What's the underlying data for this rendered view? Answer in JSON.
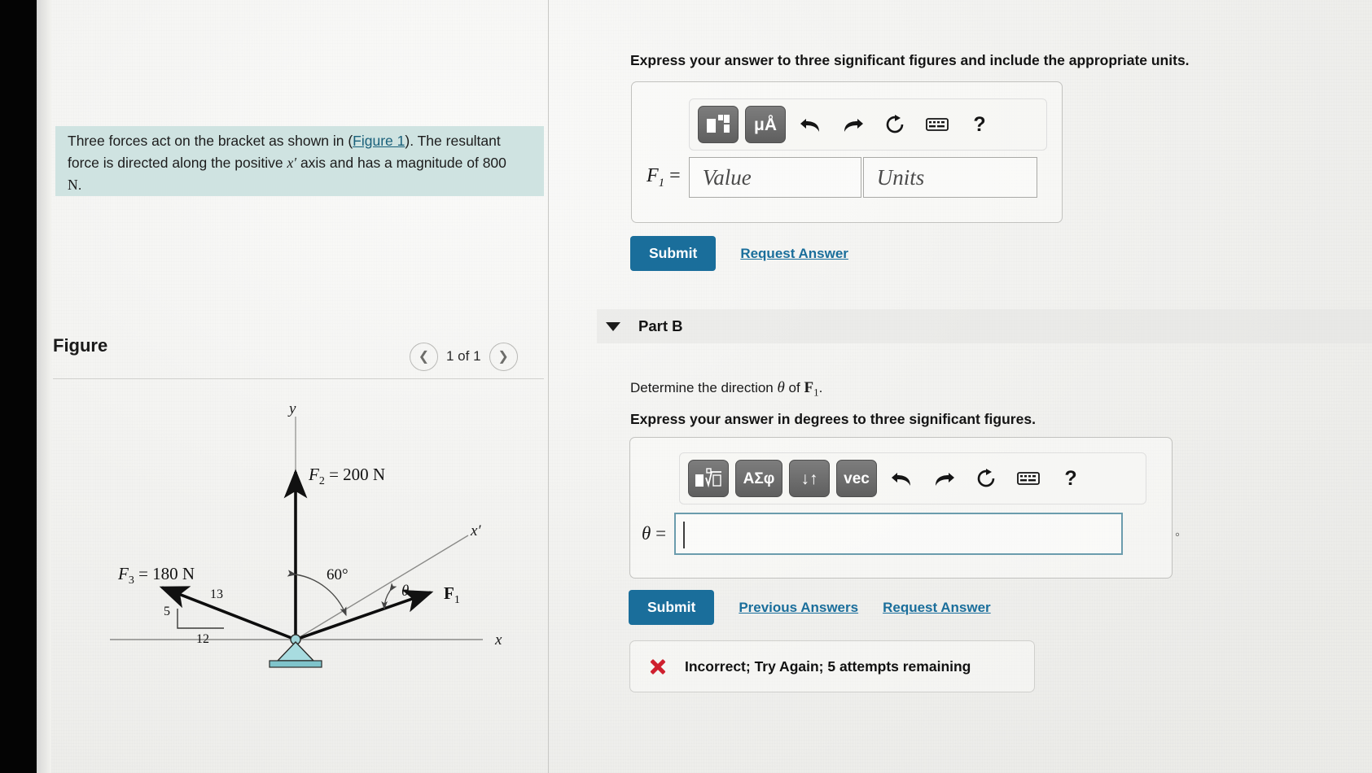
{
  "problem": {
    "text_part1": "Three forces act on the bracket as shown in (",
    "figure_link": "Figure 1",
    "text_part2": "). The resultant force is directed along the positive ",
    "axis_symbol": "x′",
    "text_part3": " axis and has a magnitude of 800 ",
    "unit": "N",
    "text_end": "."
  },
  "figure": {
    "title": "Figure",
    "pager_label": "1 of 1",
    "prev_icon": "chevron-left-icon",
    "next_icon": "chevron-right-icon",
    "labels": {
      "y_axis": "y",
      "x_axis": "x",
      "x_prime_axis": "x′",
      "f2": "F₂ = 200 N",
      "f3": "F₃ = 180 N",
      "f1": "F₁",
      "angle_60": "60°",
      "angle_theta": "θ",
      "slope_hyp": "13",
      "slope_vert": "5",
      "slope_horiz": "12"
    }
  },
  "part_a": {
    "instruction": "Express your answer to three significant figures and include the appropriate units.",
    "variable": "F",
    "variable_sub": "1",
    "equals": "=",
    "value_placeholder": "Value",
    "units_placeholder": "Units",
    "toolbar": {
      "template_key": "template-icon",
      "units_key": "μÅ",
      "undo_icon": "undo-icon",
      "redo_icon": "redo-icon",
      "reset_icon": "reset-icon",
      "keyboard_icon": "keyboard-icon",
      "help_icon": "?"
    },
    "submit_label": "Submit",
    "request_answer_label": "Request Answer"
  },
  "part_b": {
    "header_label": "Part B",
    "collapse_icon": "chevron-down-icon",
    "prompt_pre": "Determine the direction ",
    "prompt_theta": "θ",
    "prompt_mid": " of ",
    "prompt_force": "F",
    "prompt_force_sub": "1",
    "prompt_end": ".",
    "instruction": "Express your answer in degrees to three significant figures.",
    "variable": "θ",
    "equals": "=",
    "answer_value": "",
    "degree_symbol": "°",
    "toolbar": {
      "radical_key": "radical-template-icon",
      "greek_key": "ΑΣφ",
      "updown_key": "↓↑",
      "vec_key": "vec",
      "undo_icon": "undo-icon",
      "redo_icon": "redo-icon",
      "reset_icon": "reset-icon",
      "keyboard_icon": "keyboard-icon",
      "help_icon": "?"
    },
    "submit_label": "Submit",
    "previous_answers_label": "Previous Answers",
    "request_answer_label": "Request Answer",
    "feedback": {
      "icon": "incorrect-x-icon",
      "message": "Incorrect; Try Again; 5 attempts remaining"
    }
  },
  "colors": {
    "accent_blue": "#1a6e9b",
    "highlight_teal": "#cfe3e1",
    "error_red": "#cf1f2e",
    "focus_border": "#6b9cad"
  }
}
